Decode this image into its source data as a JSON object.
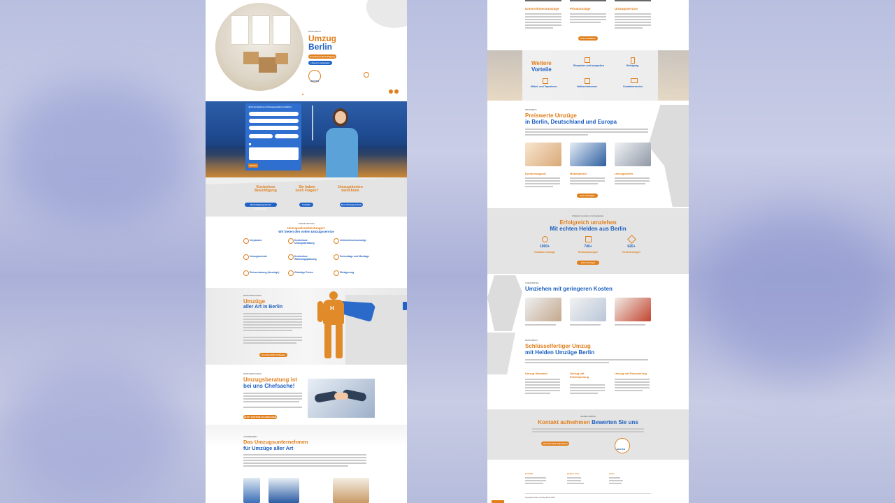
{
  "left": {
    "hero": {
      "overline": "FEHRU BECKS",
      "title1": "Umzug",
      "title2": "Berlin",
      "btn1": "Kostenlose Besichtigung",
      "btn2": "Unsere Leistungen",
      "badge": "BESTEN"
    },
    "form": {
      "title": "Jetzt kostenloses Umzugsangebot erhalten",
      "send": "Senden"
    },
    "cta3": [
      {
        "t1": "Kostenlose",
        "t2": "Besichtigung",
        "btn": "Besichtigungstermin vereinbaren"
      },
      {
        "t1": "Sie haben",
        "t2": "noch Fragen?",
        "btn": "Kontakt"
      },
      {
        "t1": "Umzugskosten",
        "t2": "berechnen",
        "btn": "Zum Umzugsrechner"
      }
    ],
    "services": {
      "overline": "UNSERE SERVICES",
      "title1": "Umzugsdienstleistungen:",
      "title2": "Wir bieten den vollen Umzugsservice",
      "items": [
        "Verpacken",
        "Kostenlose Umzugsberatung",
        "Unternehmensumzüge",
        "Umzugsschutz",
        "Kostenlose Wohnungsplanung",
        "Demontage und Montage",
        "Reinventarung (Auszüge)",
        "Günstige Preise",
        "Einlagerung"
      ]
    },
    "allart": {
      "overline": "FEHRU BECKS HERO",
      "title1": "Umzüge",
      "title2": "aller Art in Berlin",
      "btn": "Unverbindlich Anfragen"
    },
    "beratung": {
      "overline": "FEHRU BECKS HERO",
      "title1": "Umzugsberatung ist",
      "title2": "bei uns Chefsache!",
      "btn": "JETZT KOSTENLOS ANFRAGEN"
    },
    "unternehmen": {
      "overline": "UNTERNEHMEN",
      "title1": "Das Umzugsunternehmen",
      "title2": "für Umzüge aller Art"
    }
  },
  "right": {
    "top3": [
      "Unternehmensumzüge",
      "Privatumzüge",
      "Umzugsservice"
    ],
    "topbtn": "Preis Ermitteln",
    "weitere": {
      "title1": "Weitere",
      "title2": "Vorteile",
      "items": [
        "Einpacken und auspacken",
        "Reinigung",
        "Möbel- und Tapezieren",
        "Halteverbotszone",
        "Containerservice"
      ]
    },
    "preiswerte": {
      "overline": "PREISWERTE",
      "title1": "Preiswerte Umzüge",
      "title2": "in Berlin, Deutschland und Europa",
      "cards": [
        "Kundensupport",
        "Möbelpacker",
        "Umzugshelfer"
      ],
      "btn": "Jetzt Anfragen"
    },
    "stats": {
      "overline": "Erfolgreich umziehen mit Umzugshelden",
      "title1": "Erfolgreich umziehen",
      "title2": "Mit echten Helden aus Berlin",
      "items": [
        {
          "num": "1000+",
          "label": "Geplante Umzüge"
        },
        {
          "num": "740+",
          "label": "Entrümpelungen"
        },
        {
          "num": "620+",
          "label": "Renovierungen"
        }
      ],
      "btn": "Jetzt Anfragen"
    },
    "kosten": {
      "overline": "UNSER BESTES",
      "title": "Umziehen mit geringeren Kosten"
    },
    "schluessel": {
      "overline": "FEHRU BECKS",
      "title1": "Schlüsselfertiger Umzug",
      "title2": "mit Helden Umzüge Berlin",
      "cols": [
        "Umzug Standard",
        "Umzug mit Entrümpelung",
        "Umzug mit Renovierung"
      ]
    },
    "kontakt": {
      "overline": "HELDEN UMZÜGE",
      "t1": "Kontakt aufnehmen",
      "t2": "Bewerten Sie uns",
      "btn": "Jetzt Kontakt aufnehmen",
      "badge": "BESTEN"
    },
    "footer": {
      "c1": "Kontakt",
      "c2": "Helden Jobs",
      "c3": "Links",
      "copy": "Copyright Helden Umzüge Berlin 2022"
    }
  }
}
